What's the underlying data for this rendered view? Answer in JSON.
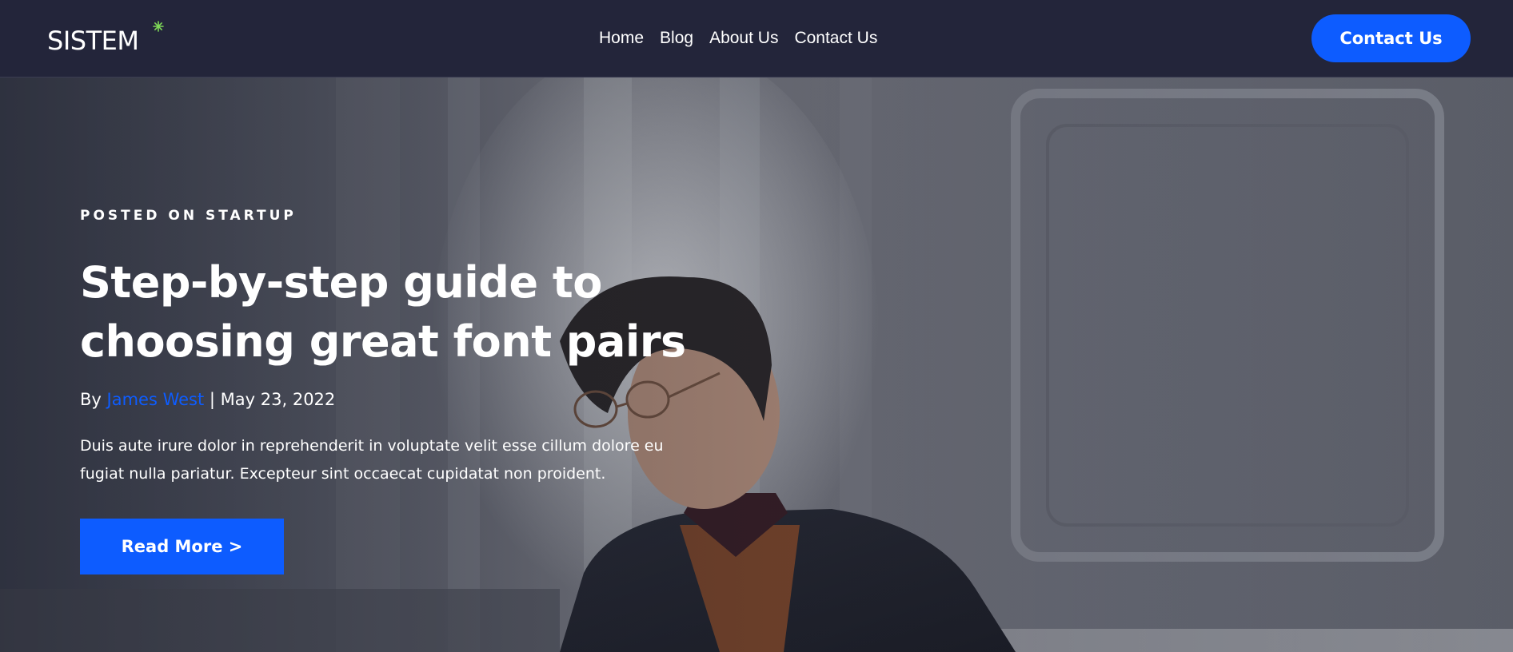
{
  "brand": {
    "logo_text": "SISTEM",
    "accent_star_color": "#7ed957"
  },
  "nav": {
    "links": [
      "Home",
      "Blog",
      "About Us",
      "Contact Us"
    ],
    "cta_label": "Contact Us"
  },
  "colors": {
    "navbar_bg": "#23253a",
    "primary": "#0d5cff",
    "text": "#ffffff"
  },
  "hero": {
    "posted_prefix": "POSTED ON",
    "category": "STARTUP",
    "title": "Step-by-step guide to choosing great font pairs",
    "by_label": "By",
    "author": "James West",
    "separator": "|",
    "date": "May 23, 2022",
    "excerpt": "Duis aute irure dolor in reprehenderit in voluptate velit esse cillum dolore eu fugiat nulla pariatur. Excepteur sint occaecat cupidatat non proident.",
    "read_more_label": "Read More >"
  }
}
